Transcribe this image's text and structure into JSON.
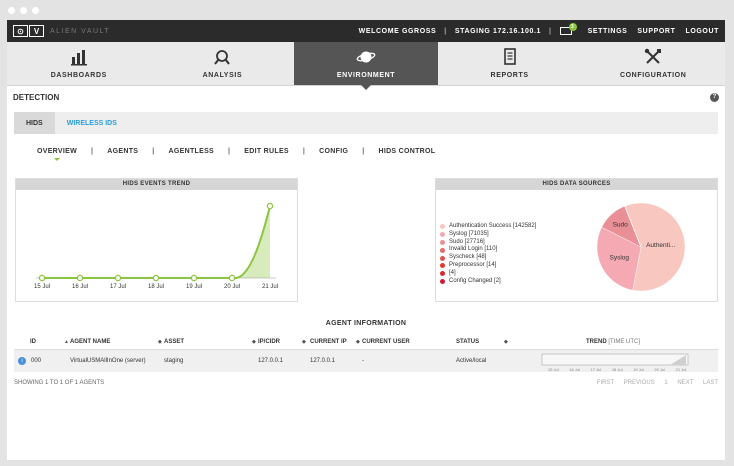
{
  "brand": {
    "logo_text": "ALIEN VAULT",
    "logo_mark": "OV"
  },
  "topbar": {
    "welcome": "WELCOME GGROSS",
    "staging": "STAGING 172.16.100.1",
    "mail_count": "3",
    "links": [
      "SETTINGS",
      "SUPPORT",
      "LOGOUT"
    ]
  },
  "nav": {
    "items": [
      {
        "label": "DASHBOARDS",
        "icon": "bar-chart-icon"
      },
      {
        "label": "ANALYSIS",
        "icon": "magnifier-icon"
      },
      {
        "label": "ENVIRONMENT",
        "icon": "planet-icon",
        "active": true
      },
      {
        "label": "REPORTS",
        "icon": "document-icon"
      },
      {
        "label": "CONFIGURATION",
        "icon": "tools-icon"
      }
    ]
  },
  "section": {
    "title": "DETECTION",
    "help": "?"
  },
  "tabs": [
    "HIDS",
    "WIRELESS IDS"
  ],
  "subnav": [
    "OVERVIEW",
    "AGENTS",
    "AGENTLESS",
    "EDIT RULES",
    "CONFIG",
    "HIDS CONTROL"
  ],
  "trend_panel": {
    "title": "HIDS EVENTS TREND"
  },
  "sources_panel": {
    "title": "HIDS DATA SOURCES"
  },
  "chart_data": [
    {
      "type": "line",
      "title": "HIDS EVENTS TREND",
      "x": [
        "15 Jul",
        "16 Jul",
        "17 Jul",
        "18 Jul",
        "19 Jul",
        "20 Jul",
        "21 Jul"
      ],
      "values": [
        0,
        0,
        0,
        0,
        0,
        0,
        1
      ],
      "color": "#8bc53f"
    },
    {
      "type": "pie",
      "title": "HIDS DATA SOURCES",
      "legend": [
        {
          "label": "Authentication Success [142582]",
          "value": 142582,
          "color": "#f8c7c0"
        },
        {
          "label": "Syslog [71035]",
          "value": 71035,
          "color": "#f4a9b3"
        },
        {
          "label": "Sudo [27716]",
          "value": 27716,
          "color": "#e98f96"
        },
        {
          "label": "Invalid Login [110]",
          "value": 110,
          "color": "#e46b6b"
        },
        {
          "label": "Syscheck [48]",
          "value": 48,
          "color": "#e05252"
        },
        {
          "label": "Preprocessor [14]",
          "value": 14,
          "color": "#e03a2e"
        },
        {
          "label": "[4]",
          "value": 4,
          "color": "#d42c2c"
        },
        {
          "label": "Config Changed [2]",
          "value": 2,
          "color": "#c81e3a"
        }
      ],
      "slice_labels": [
        "Syslog",
        "Sudo",
        "Authenti..."
      ]
    }
  ],
  "agent_info": {
    "title": "AGENT INFORMATION",
    "columns": [
      "ID",
      "AGENT NAME",
      "ASSET",
      "IP/CIDR",
      "CURRENT IP",
      "CURRENT USER",
      "STATUS",
      "TREND",
      "[TIME UTC]"
    ],
    "rows": [
      {
        "id": "000",
        "name": "VirtualUSMAllInOne (server)",
        "asset": "staging",
        "ip": "127.0.0.1",
        "current_ip": "127.0.0.1",
        "user": "-",
        "status": "Active/local"
      }
    ],
    "mini_trend_labels": [
      "15 Jul",
      "16 Jul",
      "17 Jul",
      "18 Jul",
      "19 Jul",
      "20 Jul",
      "21 Jul"
    ],
    "showing": "SHOWING 1 TO 1 OF 1 AGENTS",
    "pager": [
      "FIRST",
      "PREVIOUS",
      "1",
      "NEXT",
      "LAST"
    ]
  }
}
